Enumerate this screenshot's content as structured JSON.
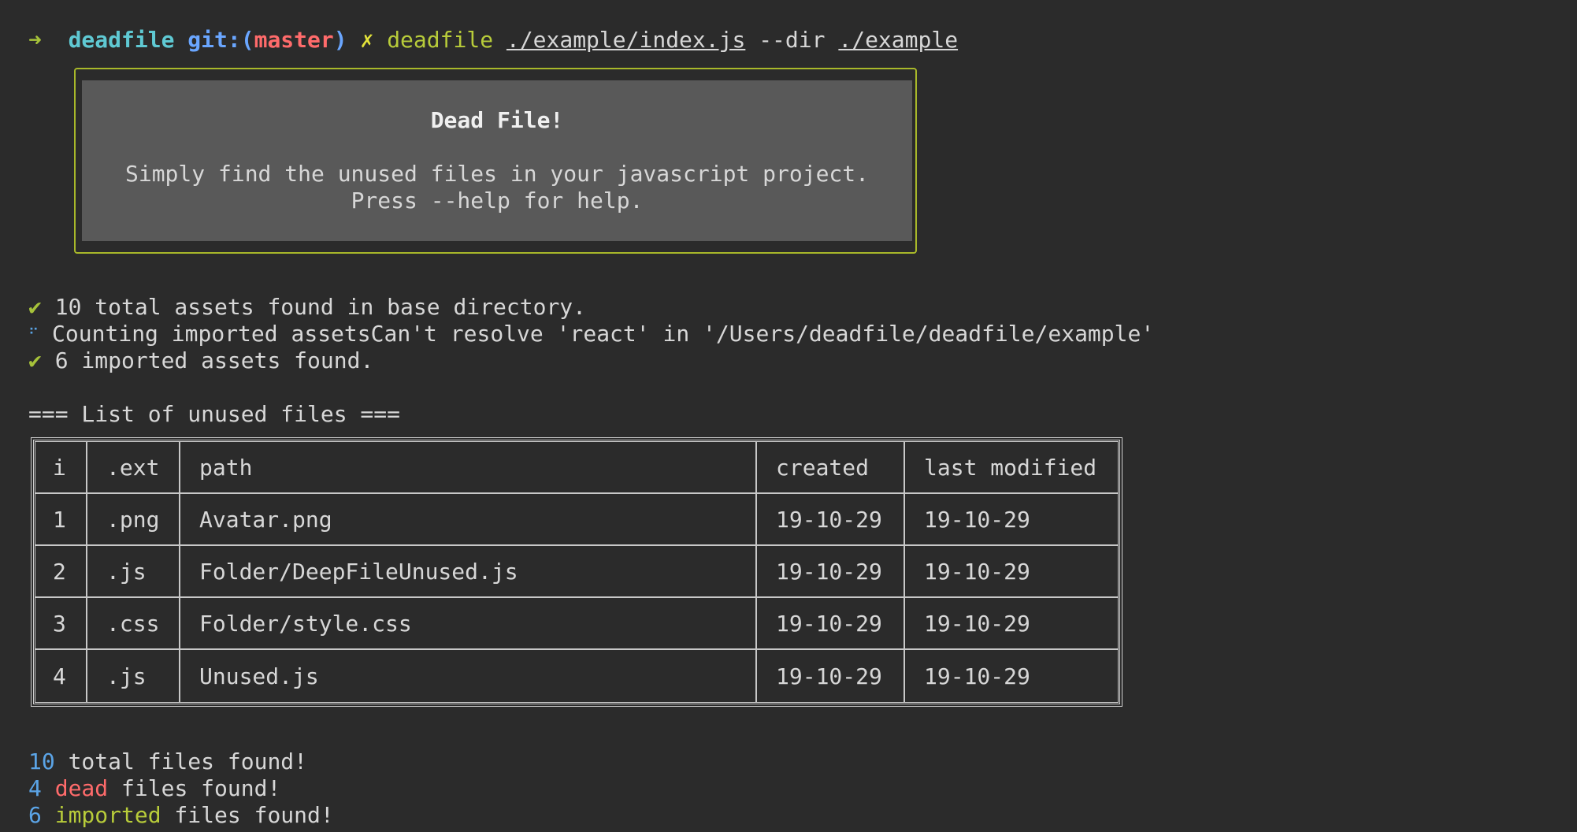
{
  "prompt": {
    "arrow": "➜",
    "dir": "deadfile",
    "git_prefix": "git:(",
    "branch": "master",
    "git_suffix": ")",
    "dirty": "✗",
    "command": "deadfile",
    "arg1": "./example/index.js",
    "flag": "--dir",
    "arg2": "./example"
  },
  "banner": {
    "title": "Dead File!",
    "line1": "Simply find the unused files in your javascript project.",
    "line2": "Press --help for help."
  },
  "status": [
    {
      "icon": "✔",
      "text": "10 total assets found in base directory."
    },
    {
      "icon": "⠋",
      "text": "Counting imported assetsCan't resolve 'react' in '/Users/deadfile/deadfile/example'"
    },
    {
      "icon": "✔",
      "text": "6 imported assets found."
    }
  ],
  "list_heading": "=== List of unused files ===",
  "table": {
    "headers": [
      "i",
      ".ext",
      "path",
      "created",
      "last modified"
    ],
    "rows": [
      [
        "1",
        ".png",
        "Avatar.png",
        "19-10-29",
        "19-10-29"
      ],
      [
        "2",
        ".js",
        "Folder/DeepFileUnused.js",
        "19-10-29",
        "19-10-29"
      ],
      [
        "3",
        ".css",
        "Folder/style.css",
        "19-10-29",
        "19-10-29"
      ],
      [
        "4",
        ".js",
        "Unused.js",
        "19-10-29",
        "19-10-29"
      ]
    ]
  },
  "summary": {
    "total": {
      "count": "10",
      "text": " total files found!"
    },
    "dead": {
      "count": "4",
      "word": "dead",
      "text": " files found!"
    },
    "imported": {
      "count": "6",
      "word": "imported",
      "text": " files found!"
    }
  },
  "colors": {
    "background": "#2b2b2b",
    "green": "#b8cc3a",
    "red": "#ff6b6b",
    "blue": "#5ba4e6",
    "cyan": "#5fc9d3"
  }
}
